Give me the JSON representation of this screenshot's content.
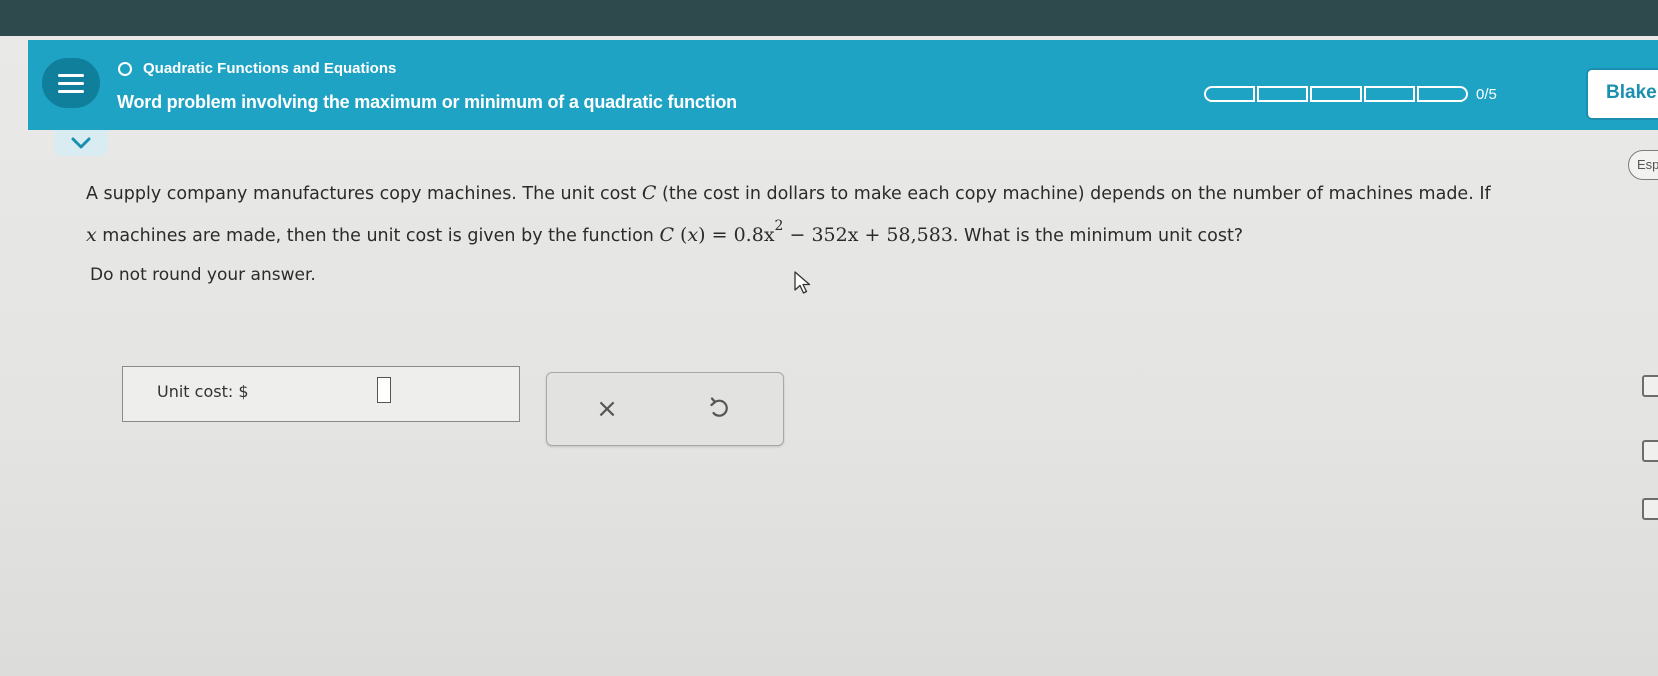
{
  "header": {
    "topic": "Quadratic Functions and Equations",
    "lesson": "Word problem involving the maximum or minimum of a quadratic function",
    "progress": {
      "completed": 0,
      "total": 5,
      "label": "0/5"
    },
    "user_name": "Blake",
    "accent_color": "#1fa3c4"
  },
  "language_button": "Esp",
  "problem": {
    "p1": "A supply company manufactures copy machines. The unit cost ",
    "var_c": "C",
    "p2": " (the cost in dollars to make each copy machine) depends on the number of machines made. If",
    "var_x": "x",
    "p3": " machines are made, then the unit cost is given by the function ",
    "fn_c": "C",
    "fn_open": " (",
    "fn_x": "x",
    "fn_close": ")",
    "fn_eq": " = ",
    "fn_coef": "0.8",
    "fn_x2": "x",
    "fn_exp": "2",
    "fn_mid": " − 352",
    "fn_x3": "x",
    "fn_end": " + 58,583",
    "p4": ". What is the minimum unit cost?",
    "instruction": "Do not round your answer."
  },
  "answer": {
    "label": "Unit cost: ",
    "currency": "$"
  },
  "tools": {
    "clear_symbol": "×"
  }
}
